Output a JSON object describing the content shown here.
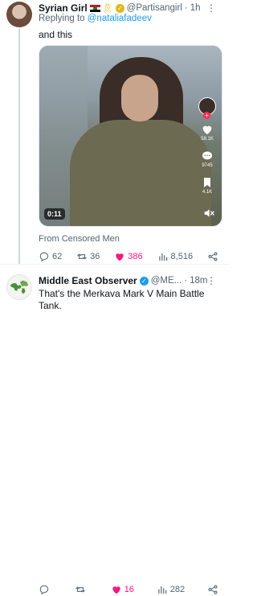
{
  "tweet1": {
    "author_name": "Syrian Girl",
    "handle": "@Partisangirl",
    "separator": "·",
    "time": "1h",
    "more": "⋮",
    "reply_prefix": "Replying to",
    "reply_handle": "@nataliafadeev",
    "text": "and this",
    "video": {
      "duration": "0:11",
      "likes": "58.1K",
      "comments": "9745",
      "shares": "4.1K"
    },
    "source": "From Censored Men",
    "actions": {
      "replies": "62",
      "retweets": "36",
      "likes": "386",
      "views": "8,516"
    }
  },
  "tweet2": {
    "author_name": "Middle East Observer",
    "handle": "@ME...",
    "separator": "·",
    "time": "18m",
    "more": "⋮",
    "text": "That's the Merkava Mark V Main Battle Tank.",
    "actions": {
      "replies": "",
      "retweets": "",
      "likes": "16",
      "views": "282"
    }
  },
  "colors": {
    "accent": "#1d9bf0",
    "like": "#f91880",
    "muted": "#536471"
  }
}
